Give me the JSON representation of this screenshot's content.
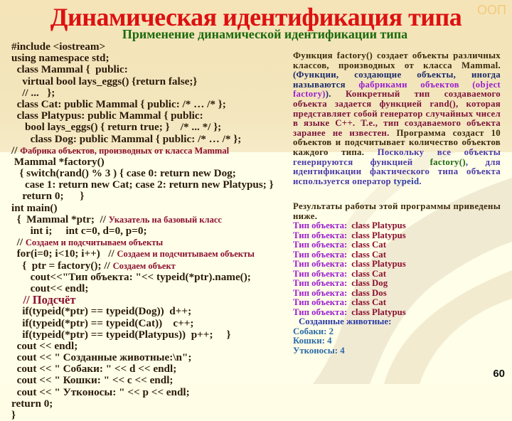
{
  "slide": {
    "title": "Динамическая идентификация типа",
    "subtitle": "Применение динамической идентификации типа",
    "corner_tag": "ООП",
    "page_number": "60"
  },
  "code": {
    "lines": [
      {
        "indent": "",
        "text": "#include <iostream>",
        "comment": ""
      },
      {
        "indent": "",
        "text": "using namespace std;",
        "comment": ""
      },
      {
        "indent": "  ",
        "text": "class Mammal {  public:",
        "comment": ""
      },
      {
        "indent": "    ",
        "text": "virtual bool lays_eggs() {return false;}",
        "comment": ""
      },
      {
        "indent": "    ",
        "text": "// ...   };",
        "comment": ""
      },
      {
        "indent": "  ",
        "text": "class Cat: public Mammal { public: /* … /* };",
        "comment": ""
      },
      {
        "indent": "  ",
        "text": "class Platypus: public Mammal { public:",
        "comment": ""
      },
      {
        "indent": "     ",
        "text": "bool lays_eggs() { return true; }    /* ... */ };",
        "comment": ""
      },
      {
        "indent": "       ",
        "text": "class Dog: public Mammal { public: /* … /* };",
        "comment": ""
      },
      {
        "indent": "",
        "text": "// ",
        "comment": "Фабрика объектов, производных от класса Mammal"
      },
      {
        "indent": " ",
        "text": "Mammal *factory()",
        "comment": ""
      },
      {
        "indent": "   ",
        "text": "{ switch(rand() % 3 ) { case 0: return new Dog;",
        "comment": ""
      },
      {
        "indent": "     ",
        "text": "case 1: return new Cat; case 2: return new Platypus; }",
        "comment": ""
      },
      {
        "indent": "    ",
        "text": "return 0;      }",
        "comment": ""
      },
      {
        "indent": "",
        "text": "int main()",
        "comment": ""
      },
      {
        "indent": "  ",
        "text": "{  Mammal *ptr;  // ",
        "comment": "Указатель на базовый класс"
      },
      {
        "indent": "       ",
        "text": "int i;     int c=0, d=0, p=0;",
        "comment": ""
      },
      {
        "indent": "  ",
        "text": "// ",
        "comment": "Создаем и подсчитываем объекты"
      },
      {
        "indent": "  ",
        "text": "for(i=0; i<10; i++)   // ",
        "comment": "Создаем и подсчитываем объекты"
      },
      {
        "indent": "    ",
        "text": "{  ptr = factory(); // ",
        "comment": "Создаем объект"
      },
      {
        "indent": "       ",
        "text": "cout<<\"Тип объекта: \"<< typeid(*ptr).name();",
        "comment": ""
      },
      {
        "indent": "       ",
        "text": "cout<< endl;",
        "comment": ""
      },
      {
        "indent": "    ",
        "text": "// Подсчёт",
        "comment": ""
      },
      {
        "indent": "    ",
        "text": "if(typeid(*ptr) == typeid(Dog))  d++;",
        "comment": ""
      },
      {
        "indent": "    ",
        "text": "if(typeid(*ptr) == typeid(Cat))    c++;",
        "comment": ""
      },
      {
        "indent": "    ",
        "text": "if(typeid(*ptr) == typeid(Platypus))  p++;     }",
        "comment": ""
      },
      {
        "indent": "  ",
        "text": "cout << endl;",
        "comment": ""
      },
      {
        "indent": "  ",
        "text": "cout << \" Созданные животные:\\n\";",
        "comment": ""
      },
      {
        "indent": "  ",
        "text": "cout << \" Собаки: \" << d << endl;",
        "comment": ""
      },
      {
        "indent": "  ",
        "text": "cout << \" Кошки: \" << c << endl;",
        "comment": ""
      },
      {
        "indent": "  ",
        "text": "cout << \" Утконосы: \" << p << endl;",
        "comment": ""
      },
      {
        "indent": "",
        "text": "return 0;",
        "comment": ""
      },
      {
        "indent": "",
        "text": "}",
        "comment": ""
      }
    ]
  },
  "description": {
    "segments": [
      {
        "color": "brown",
        "text": "Функция factory() создает объекты различных классов, производных от класса Mammal. "
      },
      {
        "color": "navy",
        "text": "(Функции, создающие объекты, иногда называются "
      },
      {
        "color": "purple",
        "text": "фабриками объектов (object factory)"
      },
      {
        "color": "navy",
        "text": "). "
      },
      {
        "color": "maroon",
        "text": "Конкретный тип создаваемого объекта задается функцией rand(), которая представляет собой генератор случайных чисел в языке C++. Т.е., тип создаваемого объекта заранее не известен. "
      },
      {
        "color": "brown",
        "text": "Программа создаст 10 объектов и подсчитывает количество объектов каждого типа. "
      },
      {
        "color": "indigo",
        "text": "Поскольку все объекты генерируются функцией "
      },
      {
        "color": "green",
        "text": "factory()"
      },
      {
        "color": "indigo",
        "text": ", для идентификации фактического типа объекта используется оператор "
      },
      {
        "color": "blue",
        "text": "typeid"
      },
      {
        "color": "indigo",
        "text": "."
      }
    ]
  },
  "results": {
    "heading": "Результаты работы этой программы приведены ниже.",
    "output_label": "Тип объекта:",
    "output_rows": [
      "class Platypus",
      "class Platypus",
      "class Cat",
      "class Cat",
      "class Platypus",
      "class Cat",
      "class Dog",
      "class Dos",
      "class Cat",
      "class Platypus"
    ],
    "created_heading": "Созданные животные:",
    "counts": [
      {
        "label": "Собаки:",
        "value": "2"
      },
      {
        "label": "Кошки:",
        "value": "4"
      },
      {
        "label": "Утконосы:",
        "value": "4"
      }
    ]
  }
}
